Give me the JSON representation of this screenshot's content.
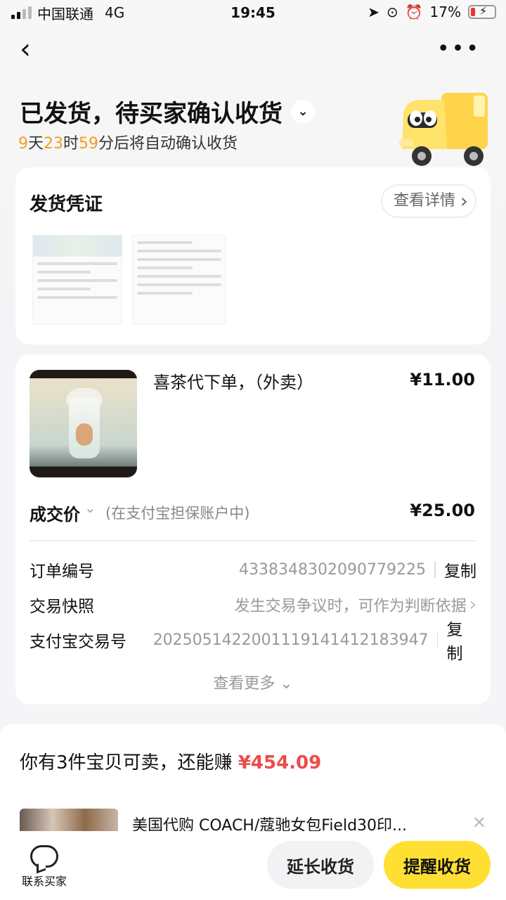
{
  "status_bar": {
    "carrier": "中国联通",
    "network": "4G",
    "time": "19:45",
    "battery": "17%"
  },
  "header": {
    "back_icon": "chevron-left-icon",
    "more_icon": "more-dots-icon",
    "title": "已发货，待买家确认收货",
    "countdown": {
      "days": "9",
      "days_unit": "天",
      "hours": "23",
      "hours_unit": "时",
      "minutes": "59",
      "suffix": "分后将自动确认收货"
    }
  },
  "voucher": {
    "title": "发货凭证",
    "detail_label": "查看详情"
  },
  "order": {
    "product_name": "喜茶代下单，（外卖）",
    "product_price": "¥11.00",
    "deal_label": "成交价",
    "deal_note": "(在支付宝担保账户中)",
    "deal_price": "¥25.00",
    "rows": [
      {
        "label": "订单编号",
        "value": "4338348302090779225",
        "action": "复制"
      },
      {
        "label": "交易快照",
        "value": "发生交易争议时，可作为判断依据"
      },
      {
        "label": "支付宝交易号",
        "value": "2025051422001119141412183947",
        "action": "复制"
      }
    ],
    "more_label": "查看更多"
  },
  "sell": {
    "prefix": "你有3件宝贝可卖，还能赚",
    "amount": "¥454.09",
    "rec_title": "美国代购 COACH/蔻驰女包Field30印..."
  },
  "bottom_bar": {
    "contact_label": "联系买家",
    "extend_label": "延长收货",
    "remind_label": "提醒收货"
  },
  "colors": {
    "accent_yellow": "#ffe032",
    "countdown_orange": "#f0a020",
    "price_red": "#ee4b4b"
  }
}
